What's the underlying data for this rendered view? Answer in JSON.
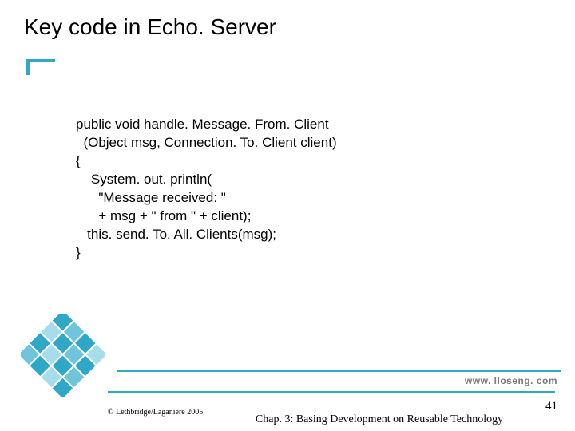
{
  "title": "Key code in  Echo. Server",
  "code": {
    "l1": "public void handle. Message. From. Client",
    "l2": "  (Object msg, Connection. To. Client client)",
    "l3": "{",
    "l4": "    System. out. println(",
    "l5": "      \"Message received: \"",
    "l6": "      + msg + \" from \" + client);",
    "l7": "   this. send. To. All. Clients(msg);",
    "l8": "}"
  },
  "footer": {
    "url": "www. lloseng. com",
    "copyright": "© Lethbridge/Laganière 2005",
    "chapter": "Chap. 3: Basing Development on Reusable Technology",
    "page": "41"
  }
}
